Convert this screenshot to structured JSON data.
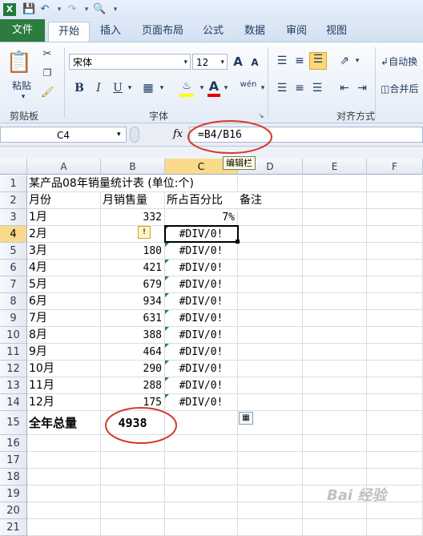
{
  "ribbon": {
    "tabs": [
      "文件",
      "开始",
      "插入",
      "页面布局",
      "公式",
      "数据",
      "审阅",
      "视图"
    ],
    "font_name": "宋体",
    "font_size": "12",
    "bold": "B",
    "italic": "I",
    "underline": "U",
    "paste_label": "粘贴",
    "groups": {
      "clipboard": "剪贴板",
      "font": "字体",
      "alignment": "对齐方式"
    },
    "wrap_label": "自动换",
    "merge_label": "合并后",
    "grow_font": "A",
    "shrink_font": "A",
    "font_color": "A",
    "phonetic": "wén"
  },
  "formula_bar": {
    "name_box": "C4",
    "fx": "fx",
    "formula": "=B4/B16",
    "tooltip": "编辑栏"
  },
  "sheet": {
    "columns": [
      "A",
      "B",
      "C",
      "D",
      "E",
      "F"
    ],
    "rows": [
      "1",
      "2",
      "3",
      "4",
      "5",
      "6",
      "7",
      "8",
      "9",
      "10",
      "11",
      "12",
      "13",
      "14",
      "15",
      "16",
      "17",
      "18",
      "19",
      "20",
      "21"
    ],
    "title": "某产品08年销量统计表 (单位:个)",
    "headers": {
      "month": "月份",
      "sales": "月销售量",
      "percent": "所占百分比",
      "note": "备注"
    },
    "data": [
      {
        "month": "1月",
        "sales": "332",
        "percent": "7%"
      },
      {
        "month": "2月",
        "sales": "",
        "percent": "#DIV/0!"
      },
      {
        "month": "3月",
        "sales": "180",
        "percent": "#DIV/0!"
      },
      {
        "month": "4月",
        "sales": "421",
        "percent": "#DIV/0!"
      },
      {
        "month": "5月",
        "sales": "679",
        "percent": "#DIV/0!"
      },
      {
        "month": "6月",
        "sales": "934",
        "percent": "#DIV/0!"
      },
      {
        "month": "7月",
        "sales": "631",
        "percent": "#DIV/0!"
      },
      {
        "month": "8月",
        "sales": "388",
        "percent": "#DIV/0!"
      },
      {
        "month": "9月",
        "sales": "464",
        "percent": "#DIV/0!"
      },
      {
        "month": "10月",
        "sales": "290",
        "percent": "#DIV/0!"
      },
      {
        "month": "11月",
        "sales": "288",
        "percent": "#DIV/0!"
      },
      {
        "month": "12月",
        "sales": "175",
        "percent": "#DIV/0!"
      }
    ],
    "total_label": "全年总量",
    "total_value": "4938",
    "error_marker": "!"
  },
  "watermark": "Bai 经验",
  "colors": {
    "file_tab": "#2b7c3e",
    "annotation": "#d43c2c",
    "selected_header": "#f9d98b",
    "error_triangle": "#1f8b2c"
  }
}
